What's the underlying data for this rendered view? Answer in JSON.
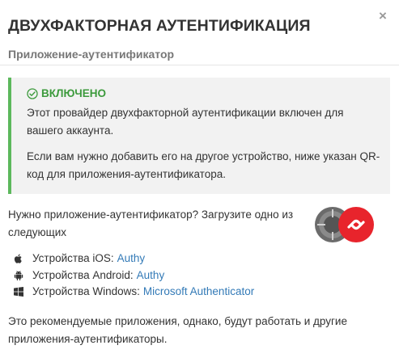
{
  "header": {
    "title": "ДВУХФАКТОРНАЯ АУТЕНТИФИКАЦИЯ",
    "subtitle": "Приложение-аутентификатор",
    "close_label": "×"
  },
  "status_alert": {
    "status_label": "ВКЛЮЧЕНО",
    "status_icon": "check-circle-icon",
    "paragraph_1": "Этот провайдер двухфакторной аутентификации включен для вашего аккаунта.",
    "paragraph_2": "Если вам нужно добавить его на другое устройство, ниже указан QR-код для приложения-аутентификатора.",
    "accent_color": "#5cb85c"
  },
  "download": {
    "prompt": "Нужно приложение-аутентификатор? Загрузите одно из следующих",
    "logos": [
      "google-authenticator-logo",
      "authy-logo"
    ],
    "platforms": [
      {
        "icon": "apple-icon",
        "label": "Устройства iOS:",
        "app": "Authy"
      },
      {
        "icon": "android-icon",
        "label": "Устройства Android:",
        "app": "Authy"
      },
      {
        "icon": "windows-icon",
        "label": "Устройства Windows:",
        "app": "Microsoft Authenticator"
      }
    ]
  },
  "footer_note": "Это рекомендуемые приложения, однако, будут работать и другие приложения-аутентификаторы.",
  "colors": {
    "link": "#337ab7",
    "success_text": "#3c9a3c",
    "alert_bg": "#f2f2f2"
  }
}
